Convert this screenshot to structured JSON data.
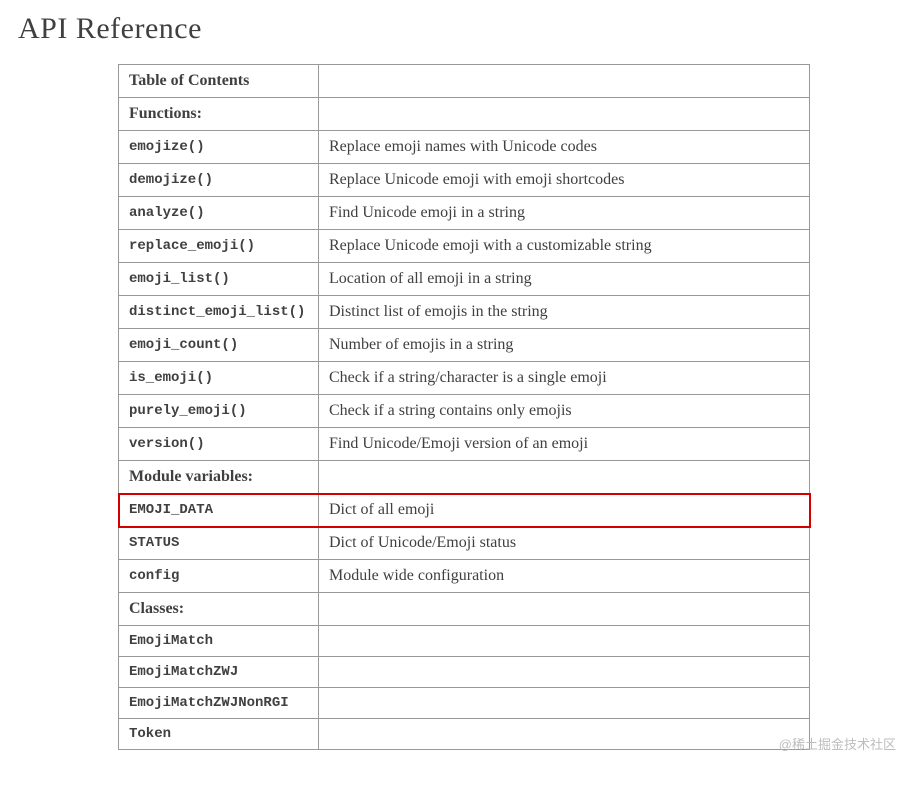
{
  "title": "API Reference",
  "headers": {
    "toc": "Table of Contents",
    "functions": "Functions:",
    "module_vars": "Module variables:",
    "classes": "Classes:"
  },
  "functions": [
    {
      "name": "emojize()",
      "desc": "Replace emoji names with Unicode codes"
    },
    {
      "name": "demojize()",
      "desc": "Replace Unicode emoji with emoji shortcodes"
    },
    {
      "name": "analyze()",
      "desc": "Find Unicode emoji in a string"
    },
    {
      "name": "replace_emoji()",
      "desc": "Replace Unicode emoji with a customizable string"
    },
    {
      "name": "emoji_list()",
      "desc": "Location of all emoji in a string"
    },
    {
      "name": "distinct_emoji_list()",
      "desc": "Distinct list of emojis in the string"
    },
    {
      "name": "emoji_count()",
      "desc": "Number of emojis in a string"
    },
    {
      "name": "is_emoji()",
      "desc": "Check if a string/character is a single emoji"
    },
    {
      "name": "purely_emoji()",
      "desc": "Check if a string contains only emojis"
    },
    {
      "name": "version()",
      "desc": "Find Unicode/Emoji version of an emoji"
    }
  ],
  "module_vars": [
    {
      "name": "EMOJI_DATA",
      "desc": "Dict of all emoji",
      "highlight": true
    },
    {
      "name": "STATUS",
      "desc": "Dict of Unicode/Emoji status"
    },
    {
      "name": "config",
      "desc": "Module wide configuration"
    }
  ],
  "classes": [
    {
      "name": "EmojiMatch",
      "desc": ""
    },
    {
      "name": "EmojiMatchZWJ",
      "desc": ""
    },
    {
      "name": "EmojiMatchZWJNonRGI",
      "desc": ""
    },
    {
      "name": "Token",
      "desc": ""
    }
  ],
  "watermark": "@稀土掘金技术社区"
}
